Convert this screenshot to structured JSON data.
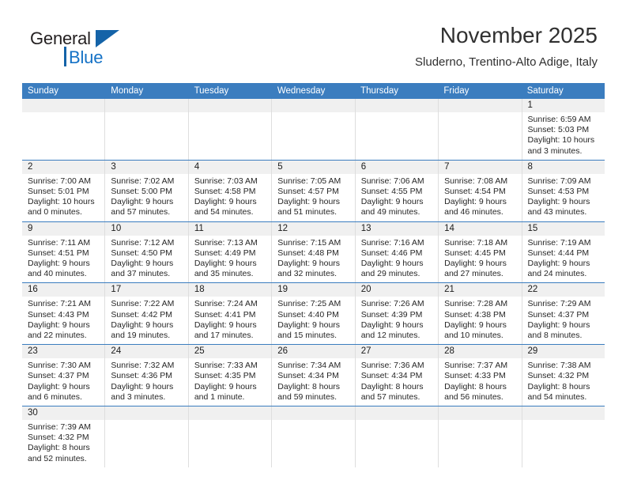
{
  "brand": {
    "name_top": "General",
    "name_bottom": "Blue",
    "logo_color": "#1463a8",
    "text_color": "#1572c6"
  },
  "header": {
    "title": "November 2025",
    "subtitle": "Sluderno, Trentino-Alto Adige, Italy"
  },
  "theme": {
    "header_blue": "#3b7dbf",
    "day_band_gray": "#f0f0f0",
    "cell_divider": "#dedede"
  },
  "weekdays": [
    "Sunday",
    "Monday",
    "Tuesday",
    "Wednesday",
    "Thursday",
    "Friday",
    "Saturday"
  ],
  "labels": {
    "sunrise": "Sunrise:",
    "sunset": "Sunset:",
    "daylight": "Daylight:"
  },
  "weeks": [
    [
      {
        "day": "",
        "empty": true
      },
      {
        "day": "",
        "empty": true
      },
      {
        "day": "",
        "empty": true
      },
      {
        "day": "",
        "empty": true
      },
      {
        "day": "",
        "empty": true
      },
      {
        "day": "",
        "empty": true
      },
      {
        "day": "1",
        "sunrise": "Sunrise: 6:59 AM",
        "sunset": "Sunset: 5:03 PM",
        "daylight_1": "Daylight: 10 hours",
        "daylight_2": "and 3 minutes."
      }
    ],
    [
      {
        "day": "2",
        "sunrise": "Sunrise: 7:00 AM",
        "sunset": "Sunset: 5:01 PM",
        "daylight_1": "Daylight: 10 hours",
        "daylight_2": "and 0 minutes."
      },
      {
        "day": "3",
        "sunrise": "Sunrise: 7:02 AM",
        "sunset": "Sunset: 5:00 PM",
        "daylight_1": "Daylight: 9 hours",
        "daylight_2": "and 57 minutes."
      },
      {
        "day": "4",
        "sunrise": "Sunrise: 7:03 AM",
        "sunset": "Sunset: 4:58 PM",
        "daylight_1": "Daylight: 9 hours",
        "daylight_2": "and 54 minutes."
      },
      {
        "day": "5",
        "sunrise": "Sunrise: 7:05 AM",
        "sunset": "Sunset: 4:57 PM",
        "daylight_1": "Daylight: 9 hours",
        "daylight_2": "and 51 minutes."
      },
      {
        "day": "6",
        "sunrise": "Sunrise: 7:06 AM",
        "sunset": "Sunset: 4:55 PM",
        "daylight_1": "Daylight: 9 hours",
        "daylight_2": "and 49 minutes."
      },
      {
        "day": "7",
        "sunrise": "Sunrise: 7:08 AM",
        "sunset": "Sunset: 4:54 PM",
        "daylight_1": "Daylight: 9 hours",
        "daylight_2": "and 46 minutes."
      },
      {
        "day": "8",
        "sunrise": "Sunrise: 7:09 AM",
        "sunset": "Sunset: 4:53 PM",
        "daylight_1": "Daylight: 9 hours",
        "daylight_2": "and 43 minutes."
      }
    ],
    [
      {
        "day": "9",
        "sunrise": "Sunrise: 7:11 AM",
        "sunset": "Sunset: 4:51 PM",
        "daylight_1": "Daylight: 9 hours",
        "daylight_2": "and 40 minutes."
      },
      {
        "day": "10",
        "sunrise": "Sunrise: 7:12 AM",
        "sunset": "Sunset: 4:50 PM",
        "daylight_1": "Daylight: 9 hours",
        "daylight_2": "and 37 minutes."
      },
      {
        "day": "11",
        "sunrise": "Sunrise: 7:13 AM",
        "sunset": "Sunset: 4:49 PM",
        "daylight_1": "Daylight: 9 hours",
        "daylight_2": "and 35 minutes."
      },
      {
        "day": "12",
        "sunrise": "Sunrise: 7:15 AM",
        "sunset": "Sunset: 4:48 PM",
        "daylight_1": "Daylight: 9 hours",
        "daylight_2": "and 32 minutes."
      },
      {
        "day": "13",
        "sunrise": "Sunrise: 7:16 AM",
        "sunset": "Sunset: 4:46 PM",
        "daylight_1": "Daylight: 9 hours",
        "daylight_2": "and 29 minutes."
      },
      {
        "day": "14",
        "sunrise": "Sunrise: 7:18 AM",
        "sunset": "Sunset: 4:45 PM",
        "daylight_1": "Daylight: 9 hours",
        "daylight_2": "and 27 minutes."
      },
      {
        "day": "15",
        "sunrise": "Sunrise: 7:19 AM",
        "sunset": "Sunset: 4:44 PM",
        "daylight_1": "Daylight: 9 hours",
        "daylight_2": "and 24 minutes."
      }
    ],
    [
      {
        "day": "16",
        "sunrise": "Sunrise: 7:21 AM",
        "sunset": "Sunset: 4:43 PM",
        "daylight_1": "Daylight: 9 hours",
        "daylight_2": "and 22 minutes."
      },
      {
        "day": "17",
        "sunrise": "Sunrise: 7:22 AM",
        "sunset": "Sunset: 4:42 PM",
        "daylight_1": "Daylight: 9 hours",
        "daylight_2": "and 19 minutes."
      },
      {
        "day": "18",
        "sunrise": "Sunrise: 7:24 AM",
        "sunset": "Sunset: 4:41 PM",
        "daylight_1": "Daylight: 9 hours",
        "daylight_2": "and 17 minutes."
      },
      {
        "day": "19",
        "sunrise": "Sunrise: 7:25 AM",
        "sunset": "Sunset: 4:40 PM",
        "daylight_1": "Daylight: 9 hours",
        "daylight_2": "and 15 minutes."
      },
      {
        "day": "20",
        "sunrise": "Sunrise: 7:26 AM",
        "sunset": "Sunset: 4:39 PM",
        "daylight_1": "Daylight: 9 hours",
        "daylight_2": "and 12 minutes."
      },
      {
        "day": "21",
        "sunrise": "Sunrise: 7:28 AM",
        "sunset": "Sunset: 4:38 PM",
        "daylight_1": "Daylight: 9 hours",
        "daylight_2": "and 10 minutes."
      },
      {
        "day": "22",
        "sunrise": "Sunrise: 7:29 AM",
        "sunset": "Sunset: 4:37 PM",
        "daylight_1": "Daylight: 9 hours",
        "daylight_2": "and 8 minutes."
      }
    ],
    [
      {
        "day": "23",
        "sunrise": "Sunrise: 7:30 AM",
        "sunset": "Sunset: 4:37 PM",
        "daylight_1": "Daylight: 9 hours",
        "daylight_2": "and 6 minutes."
      },
      {
        "day": "24",
        "sunrise": "Sunrise: 7:32 AM",
        "sunset": "Sunset: 4:36 PM",
        "daylight_1": "Daylight: 9 hours",
        "daylight_2": "and 3 minutes."
      },
      {
        "day": "25",
        "sunrise": "Sunrise: 7:33 AM",
        "sunset": "Sunset: 4:35 PM",
        "daylight_1": "Daylight: 9 hours",
        "daylight_2": "and 1 minute."
      },
      {
        "day": "26",
        "sunrise": "Sunrise: 7:34 AM",
        "sunset": "Sunset: 4:34 PM",
        "daylight_1": "Daylight: 8 hours",
        "daylight_2": "and 59 minutes."
      },
      {
        "day": "27",
        "sunrise": "Sunrise: 7:36 AM",
        "sunset": "Sunset: 4:34 PM",
        "daylight_1": "Daylight: 8 hours",
        "daylight_2": "and 57 minutes."
      },
      {
        "day": "28",
        "sunrise": "Sunrise: 7:37 AM",
        "sunset": "Sunset: 4:33 PM",
        "daylight_1": "Daylight: 8 hours",
        "daylight_2": "and 56 minutes."
      },
      {
        "day": "29",
        "sunrise": "Sunrise: 7:38 AM",
        "sunset": "Sunset: 4:32 PM",
        "daylight_1": "Daylight: 8 hours",
        "daylight_2": "and 54 minutes."
      }
    ],
    [
      {
        "day": "30",
        "sunrise": "Sunrise: 7:39 AM",
        "sunset": "Sunset: 4:32 PM",
        "daylight_1": "Daylight: 8 hours",
        "daylight_2": "and 52 minutes."
      },
      {
        "day": "",
        "empty": true
      },
      {
        "day": "",
        "empty": true
      },
      {
        "day": "",
        "empty": true
      },
      {
        "day": "",
        "empty": true
      },
      {
        "day": "",
        "empty": true
      },
      {
        "day": "",
        "empty": true
      }
    ]
  ]
}
